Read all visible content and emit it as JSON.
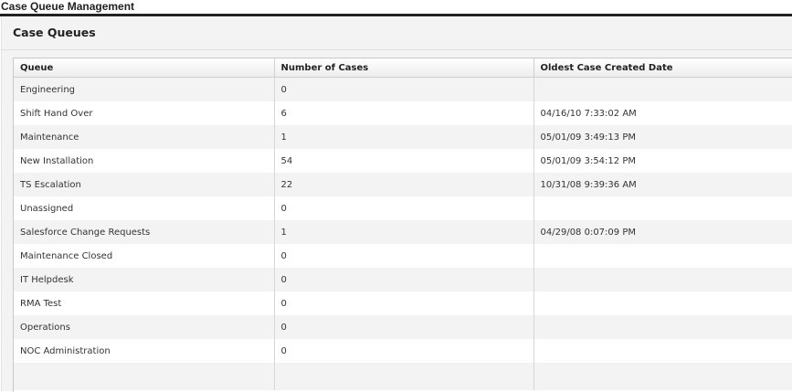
{
  "page": {
    "title": "Case Queue Management"
  },
  "panel": {
    "title": "Case Queues"
  },
  "table": {
    "columns": [
      "Queue",
      "Number of Cases",
      "Oldest Case Created Date"
    ],
    "rows": [
      {
        "queue": "Engineering",
        "count": "0",
        "oldest": ""
      },
      {
        "queue": "Shift Hand Over",
        "count": "6",
        "oldest": "04/16/10 7:33:02 AM"
      },
      {
        "queue": "Maintenance",
        "count": "1",
        "oldest": "05/01/09 3:49:13 PM"
      },
      {
        "queue": "New Installation",
        "count": "54",
        "oldest": "05/01/09 3:54:12 PM"
      },
      {
        "queue": "TS Escalation",
        "count": "22",
        "oldest": "10/31/08 9:39:36 AM"
      },
      {
        "queue": "Unassigned",
        "count": "0",
        "oldest": ""
      },
      {
        "queue": "Salesforce Change Requests",
        "count": "1",
        "oldest": "04/29/08 0:07:09 PM"
      },
      {
        "queue": "Maintenance Closed",
        "count": "0",
        "oldest": ""
      },
      {
        "queue": "IT Helpdesk",
        "count": "0",
        "oldest": ""
      },
      {
        "queue": "RMA Test",
        "count": "0",
        "oldest": ""
      },
      {
        "queue": "Operations",
        "count": "0",
        "oldest": ""
      },
      {
        "queue": "NOC Administration",
        "count": "0",
        "oldest": ""
      }
    ]
  }
}
